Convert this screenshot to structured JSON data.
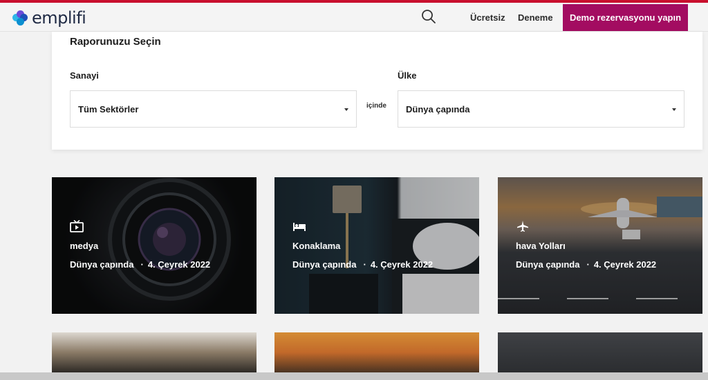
{
  "header": {
    "logo_text": "emplifi",
    "nav": {
      "free_label": "Ücretsiz",
      "trial_label": "Deneme",
      "demo_label": "Demo rezervasyonu yapın"
    }
  },
  "report_panel": {
    "title": "Raporunuzu Seçin",
    "sector_label": "Sanayi",
    "sector_value": "Tüm Sektörler",
    "in_label": "içinde",
    "country_label": "Ülke",
    "country_value": "Dünya çapında"
  },
  "cards": [
    {
      "icon": "tv-icon",
      "title": "medya",
      "region": "Dünya çapında",
      "period": "4. Çeyrek 2022"
    },
    {
      "icon": "bed-icon",
      "title": "Konaklama",
      "region": "Dünya çapında",
      "period": "4. Çeyrek 2022"
    },
    {
      "icon": "airplane-icon",
      "title": "hava Yolları",
      "region": "Dünya çapında",
      "period": "4. Çeyrek 2022"
    }
  ],
  "colors": {
    "accent_bar": "#c8102e",
    "demo_button": "#a30c61",
    "page_bg": "#f2f2f2"
  }
}
